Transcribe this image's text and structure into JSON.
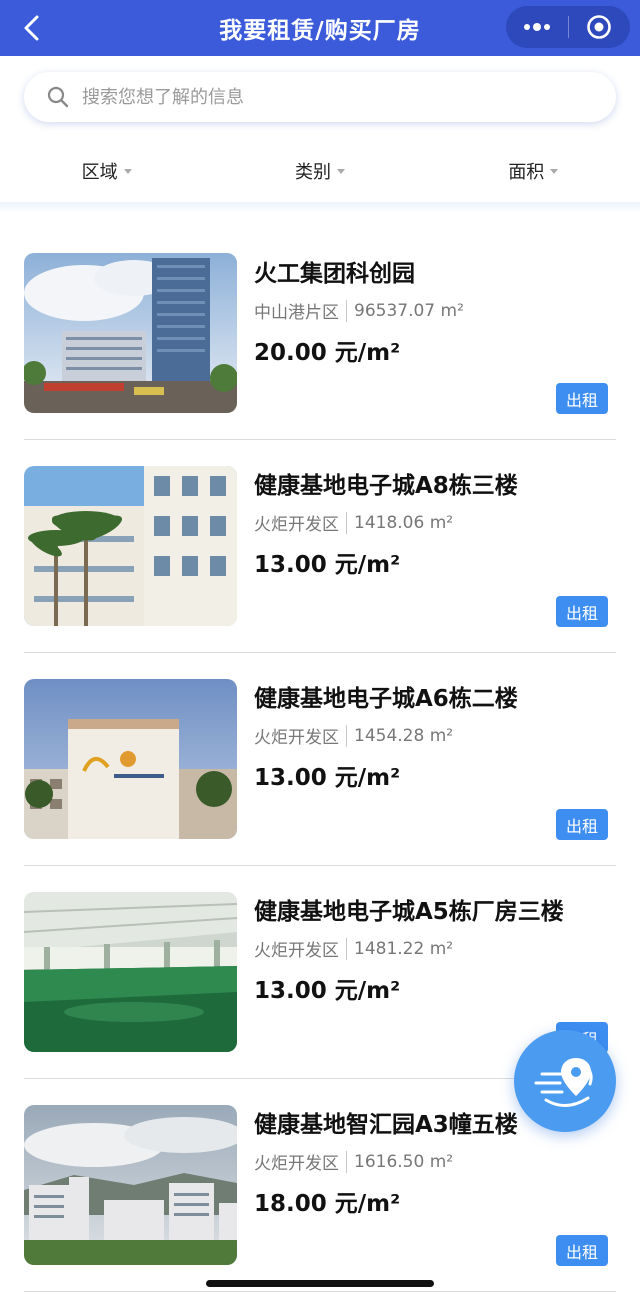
{
  "header": {
    "title": "我要租赁/购买厂房",
    "icons": {
      "back": "back-icon",
      "more": "more-icon",
      "close": "target-icon"
    },
    "color": "#3b5bdb"
  },
  "search": {
    "placeholder": "搜索您想了解的信息"
  },
  "filters": [
    {
      "label": "区域"
    },
    {
      "label": "类别"
    },
    {
      "label": "面积"
    }
  ],
  "listings": [
    {
      "title": "火工集团科创园",
      "district": "中山港片区",
      "area": "96537.07 m²",
      "price": "20.00 元/m²",
      "badge": "出租",
      "image": "tower-building"
    },
    {
      "title": "健康基地电子城A8栋三楼",
      "district": "火炬开发区",
      "area": "1418.06 m²",
      "price": "13.00 元/m²",
      "badge": "出租",
      "image": "palm-building"
    },
    {
      "title": "健康基地电子城A6栋二楼",
      "district": "火炬开发区",
      "area": "1454.28 m²",
      "price": "13.00 元/m²",
      "badge": "出租",
      "image": "factory-sign"
    },
    {
      "title": "健康基地电子城A5栋厂房三楼",
      "district": "火炬开发区",
      "area": "1481.22 m²",
      "price": "13.00 元/m²",
      "badge": "出租",
      "image": "empty-floor"
    },
    {
      "title": "健康基地智汇园A3幢五楼",
      "district": "火炬开发区",
      "area": "1616.50 m²",
      "price": "18.00 元/m²",
      "badge": "出租",
      "image": "aerial-park"
    }
  ],
  "fab": {
    "icon": "map-location-icon"
  },
  "colors": {
    "accent": "#3d8ef0",
    "fab": "#4b9cf0"
  }
}
